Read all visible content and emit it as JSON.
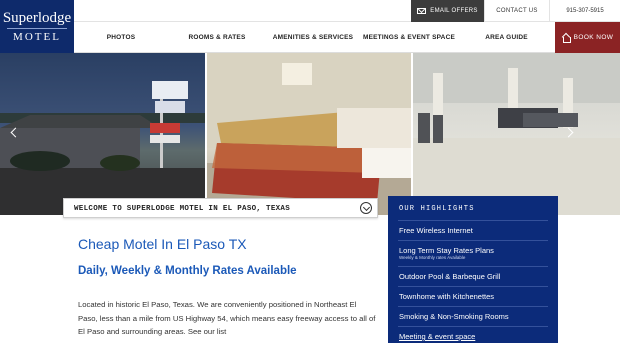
{
  "logo": {
    "line1": "Superlodge",
    "line2": "MOTEL"
  },
  "topbar": {
    "email": "EMAIL OFFERS",
    "contact": "CONTACT US",
    "phone": "915-307-5915"
  },
  "nav": {
    "items": [
      "PHOTOS",
      "ROOMS & RATES",
      "AMENITIES & SERVICES",
      "MEETINGS & EVENT SPACE",
      "AREA GUIDE"
    ],
    "book": "BOOK NOW"
  },
  "welcome": "WELCOME TO SUPERLODGE MOTEL IN EL PASO, TEXAS",
  "main": {
    "title": "Cheap Motel In El Paso TX",
    "subtitle": "Daily, Weekly & Monthly Rates Available",
    "body": "Located in historic El Paso, Texas. We are conveniently positioned in Northeast El Paso, less than a mile from US Highway 54, which means easy freeway access to all of El Paso and surrounding areas. See our list"
  },
  "highlights": {
    "title": "OUR HIGHLIGHTS",
    "items": [
      {
        "label": "Free Wireless Internet",
        "sub": ""
      },
      {
        "label": "Long Term Stay Rates Plans",
        "sub": "Weekly & Monthly rates Available"
      },
      {
        "label": "Outdoor Pool & Barbeque Grill",
        "sub": ""
      },
      {
        "label": "Townhome with Kitchenettes",
        "sub": ""
      },
      {
        "label": "Smoking & Non-Smoking Rooms",
        "sub": ""
      },
      {
        "label": "Meeting & event space",
        "sub": ""
      }
    ]
  },
  "colors": {
    "brand_navy": "#0e2a6b",
    "highlight_panel": "#0c2b7a",
    "book_red": "#8b2324",
    "heading_blue": "#1b59b8"
  }
}
